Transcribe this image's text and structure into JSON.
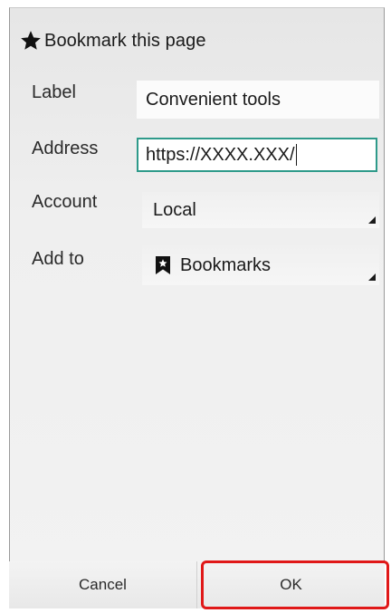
{
  "dialog": {
    "title": "Bookmark this page",
    "title_icon": "star-icon"
  },
  "form": {
    "label": {
      "label": "Label",
      "value": "Convenient tools"
    },
    "address": {
      "label": "Address",
      "value": "https://XXXX.XXX/"
    },
    "account": {
      "label": "Account",
      "value": "Local"
    },
    "add_to": {
      "label": "Add to",
      "value": "Bookmarks",
      "icon": "bookmark-star-icon"
    }
  },
  "buttons": {
    "cancel": "Cancel",
    "ok": "OK"
  },
  "colors": {
    "focus_border": "#2e9a8a",
    "highlight": "#e01818"
  }
}
